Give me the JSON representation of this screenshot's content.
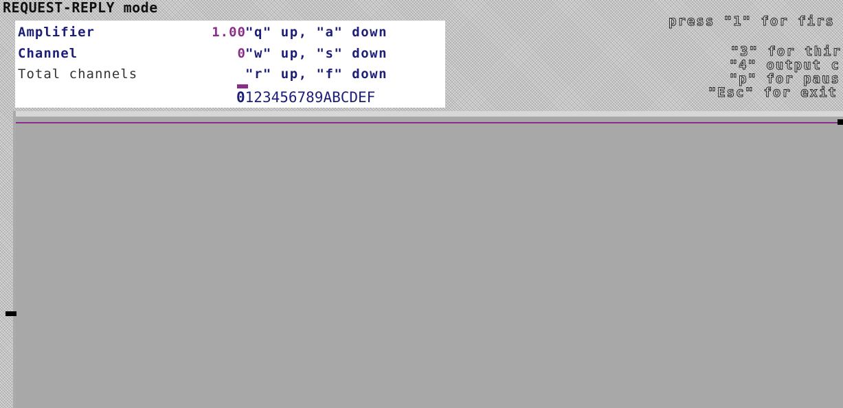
{
  "header": {
    "mode_title": "REQUEST-REPLY mode"
  },
  "controls": {
    "amplifier": {
      "label": "Amplifier",
      "value": "1.00",
      "keys": "\"q\" up, \"a\" down"
    },
    "channel": {
      "label": "Channel",
      "value": "0",
      "keys": "\"w\" up, \"s\" down"
    },
    "total_channels": {
      "label": "Total channels",
      "value": "",
      "keys": "\"r\" up, \"f\" down"
    },
    "channel_strip": {
      "selected": "0",
      "rest": "123456789ABCDEF"
    }
  },
  "help": {
    "line1": "press \"1\" for firs",
    "line3": "\"3\" for thir",
    "line4": "\"4\" output c",
    "line5": "\"p\" for paus",
    "line6": "\"Esc\" for exit"
  },
  "colors": {
    "label": "#1d1d7a",
    "value": "#8a2c8a",
    "plot_background": "#a8a8a8",
    "signal_line": "#8a2c8a"
  }
}
